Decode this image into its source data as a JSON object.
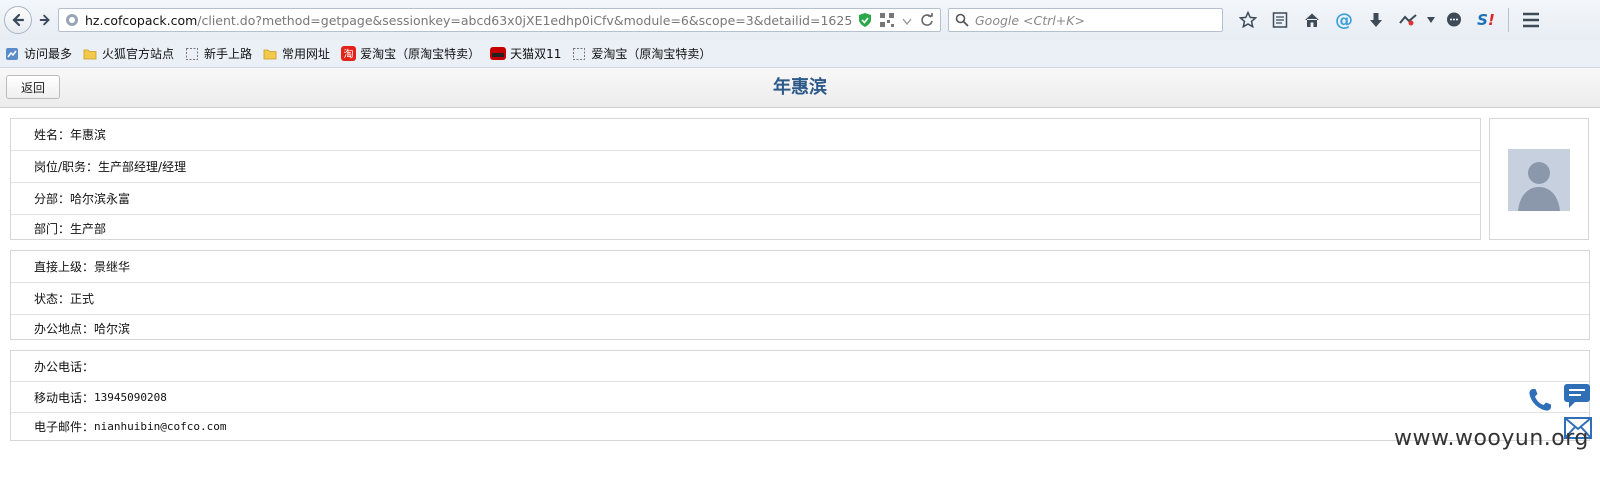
{
  "browser": {
    "url_prefix": "",
    "url_host": "hz.cofcopack.com",
    "url_path": "/client.do?method=getpage&sessionkey=abcd63x0jXE1edhp0iCfv&module=6&scope=3&detailid=1625",
    "search_placeholder": "Google <Ctrl+K>"
  },
  "bookmarks": [
    {
      "label": "访问最多",
      "icon": "most-visited-icon"
    },
    {
      "label": "火狐官方站点",
      "icon": "folder-icon"
    },
    {
      "label": "新手上路",
      "icon": "blank-page-icon"
    },
    {
      "label": "常用网址",
      "icon": "folder-icon"
    },
    {
      "label": "爱淘宝（原淘宝特卖）",
      "icon": "taobao-icon"
    },
    {
      "label": "天猫双11",
      "icon": "tmall-icon"
    },
    {
      "label": "爱淘宝（原淘宝特卖）",
      "icon": "blank-page-icon"
    }
  ],
  "header": {
    "back_label": "返回",
    "title": "年惠滨"
  },
  "profile": {
    "name_label": "姓名：",
    "name": "年惠滨",
    "position_label": "岗位/职务：",
    "position": "生产部经理/经理",
    "branch_label": "分部：",
    "branch": "哈尔滨永富",
    "dept_label": "部门：",
    "dept": "生产部"
  },
  "org": {
    "manager_label": "直接上级：",
    "manager": "景继华",
    "status_label": "状态：",
    "status": "正式",
    "location_label": "办公地点：",
    "location": "哈尔滨"
  },
  "contact": {
    "office_phone_label": "办公电话：",
    "office_phone": "",
    "mobile_label": "移动电话：",
    "mobile": "13945090208",
    "email_label": "电子邮件：",
    "email": "nianhuibin@cofco.com"
  },
  "watermark": "www.wooyun.org",
  "colors": {
    "title": "#2e5a8a",
    "accent": "#2f6fb7"
  }
}
